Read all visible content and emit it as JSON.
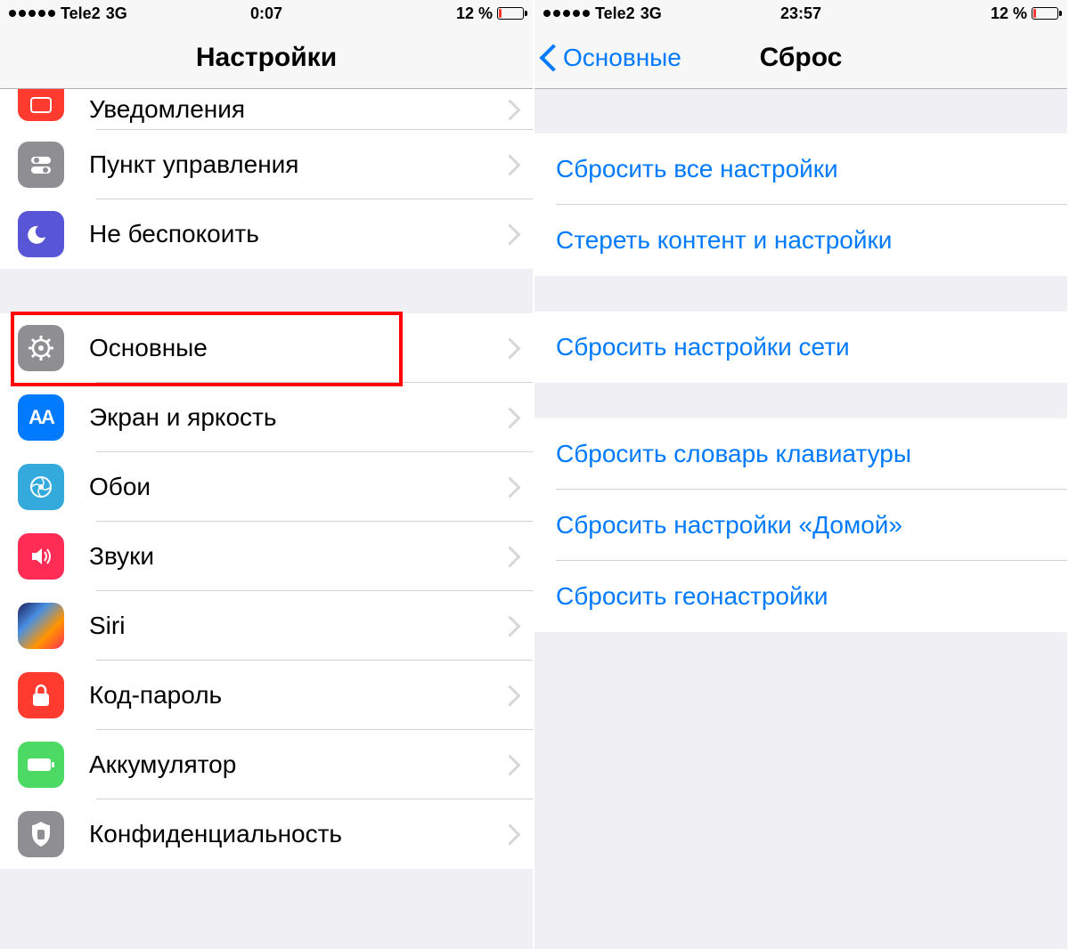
{
  "left": {
    "status": {
      "carrier": "Tele2",
      "net": "3G",
      "time": "0:07",
      "battery_pct": "12 %",
      "battery_level_pct": 12
    },
    "nav": {
      "title": "Настройки"
    },
    "rows": [
      {
        "key": "notifications",
        "label": "Уведомления"
      },
      {
        "key": "control-center",
        "label": "Пункт управления"
      },
      {
        "key": "dnd",
        "label": "Не беспокоить"
      },
      {
        "key": "general",
        "label": "Основные"
      },
      {
        "key": "display",
        "label": "Экран и яркость"
      },
      {
        "key": "wallpaper",
        "label": "Обои"
      },
      {
        "key": "sounds",
        "label": "Звуки"
      },
      {
        "key": "siri",
        "label": "Siri"
      },
      {
        "key": "passcode",
        "label": "Код-пароль"
      },
      {
        "key": "battery",
        "label": "Аккумулятор"
      },
      {
        "key": "privacy",
        "label": "Конфиденциальность"
      }
    ],
    "highlight_row_key": "general"
  },
  "right": {
    "status": {
      "carrier": "Tele2",
      "net": "3G",
      "time": "23:57",
      "battery_pct": "12 %",
      "battery_level_pct": 12
    },
    "nav": {
      "back": "Основные",
      "title": "Сброс"
    },
    "groups": [
      [
        "Сбросить все настройки",
        "Стереть контент и настройки"
      ],
      [
        "Сбросить настройки сети"
      ],
      [
        "Сбросить словарь клавиатуры",
        "Сбросить настройки «Домой»",
        "Сбросить геонастройки"
      ]
    ]
  }
}
